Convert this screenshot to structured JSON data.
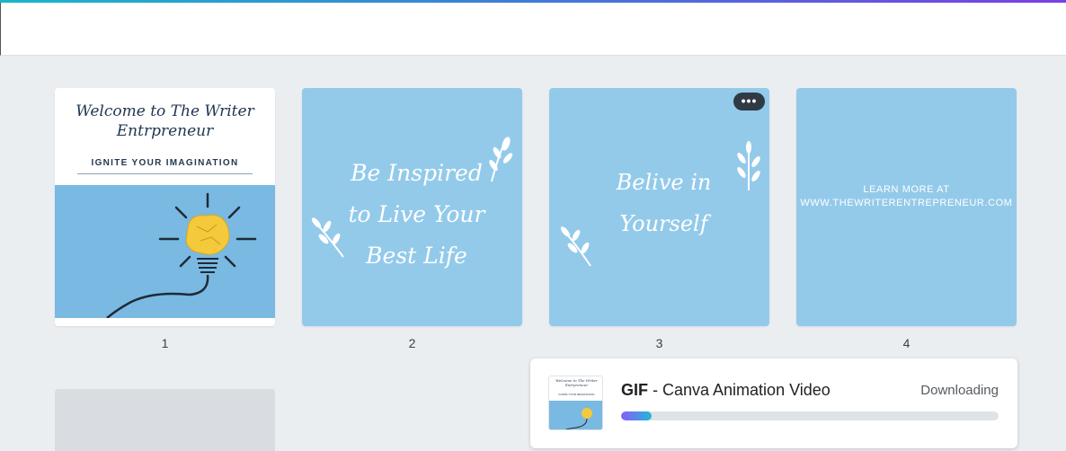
{
  "colors": {
    "accent_gradient": [
      "#19b7c9",
      "#7b3fe4"
    ],
    "page_bg": "#93caea",
    "canvas_bg": "#ebeef1"
  },
  "pages": [
    {
      "number": "1",
      "title": "Welcome to The Writer Entrpreneur",
      "subtitle": "IGNITE YOUR IMAGINATION",
      "image": "lightbulb-icon"
    },
    {
      "number": "2",
      "quote_lines": [
        "Be Inspired",
        "to Live Your",
        "Best Life"
      ]
    },
    {
      "number": "3",
      "quote_lines": [
        "Belive in",
        "Yourself"
      ]
    },
    {
      "number": "4",
      "text_lines": [
        "LEARN MORE AT",
        "WWW.THEWRITERENTREPRENEUR.COM"
      ]
    }
  ],
  "more_button": {
    "label": "•••",
    "icon": "more-options-icon"
  },
  "download": {
    "format": "GIF",
    "separator": " - ",
    "description": "Canva Animation Video",
    "status": "Downloading",
    "progress": 0.08,
    "thumb_title": "Welcome to The Writer Entrpreneur",
    "thumb_subtitle": "IGNITE YOUR IMAGINATION"
  }
}
